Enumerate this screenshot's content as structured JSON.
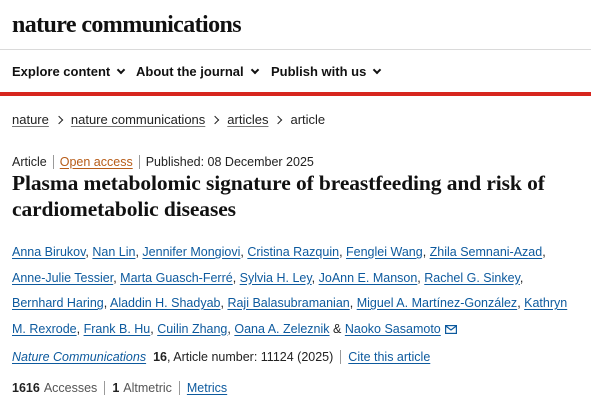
{
  "brand": "nature communications",
  "nav": {
    "items": [
      {
        "label": "Explore content"
      },
      {
        "label": "About the journal"
      },
      {
        "label": "Publish with us"
      }
    ]
  },
  "breadcrumb": {
    "items": [
      "nature",
      "nature communications",
      "articles"
    ],
    "current": "article"
  },
  "article_meta": {
    "type": "Article",
    "access": "Open access",
    "published": "Published: 08 December 2025"
  },
  "title": "Plasma metabolomic signature of breastfeeding and risk of cardiometabolic diseases",
  "authors": [
    "Anna Birukov",
    "Nan Lin",
    "Jennifer Mongiovi",
    "Cristina Razquin",
    "Fenglei Wang",
    "Zhila Semnani-Azad",
    "Anne-Julie Tessier",
    "Marta Guasch-Ferré",
    "Sylvia H. Ley",
    "JoAnn E. Manson",
    "Rachel G. Sinkey",
    "Bernhard Haring",
    "Aladdin H. Shadyab",
    "Raji Balasubramanian",
    "Miguel A. Martínez-González",
    "Kathryn M. Rexrode",
    "Frank B. Hu",
    "Cuilin Zhang",
    "Oana A. Zeleznik",
    "Naoko Sasamoto"
  ],
  "authors_joiner": "&",
  "citation": {
    "journal": "Nature Communications",
    "volume": "16",
    "article_number": ", Article number: 11124 (2025)",
    "cite_label": "Cite this article"
  },
  "metrics": {
    "accesses_count": "1616",
    "accesses_label": "Accesses",
    "altmetric_count": "1",
    "altmetric_label": "Altmetric",
    "metrics_label": "Metrics"
  },
  "colors": {
    "accent_red": "#d7261e",
    "link_blue": "#0d5a9e",
    "open_access_orange": "#b75c18"
  },
  "icons": {
    "nav_chevron": "chevron-down-icon",
    "breadcrumb_separator": "chevron-right-icon",
    "corresponding_author": "mail-icon"
  }
}
